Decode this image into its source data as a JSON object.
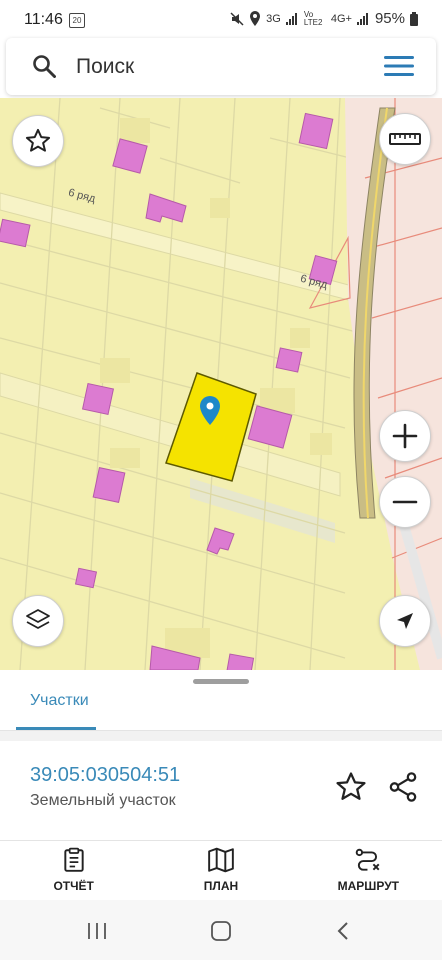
{
  "status_bar": {
    "time": "11:46",
    "notification_tag": "20",
    "network_1": "3G",
    "network_2": "Vo LTE2",
    "network_3": "4G+",
    "battery": "95%"
  },
  "search": {
    "placeholder": "Поиск"
  },
  "map": {
    "street_label_top": "6 ряд",
    "street_label_right": "6 ряд",
    "colors": {
      "land": "#f3efb1",
      "parcel_line": "#ddd9a5",
      "building": "#dc7bd1",
      "selected_parcel": "#f5e300",
      "road": "#c9bd85",
      "pin": "#1e88c9"
    }
  },
  "panel": {
    "tab_label": "Участки",
    "cadastral_number": "39:05:030504:51",
    "parcel_type": "Земельный участок",
    "actions": [
      {
        "label": "ОТЧЁТ",
        "icon": "report-icon"
      },
      {
        "label": "ПЛАН",
        "icon": "map-plan-icon"
      },
      {
        "label": "МАРШРУТ",
        "icon": "route-icon"
      }
    ]
  }
}
